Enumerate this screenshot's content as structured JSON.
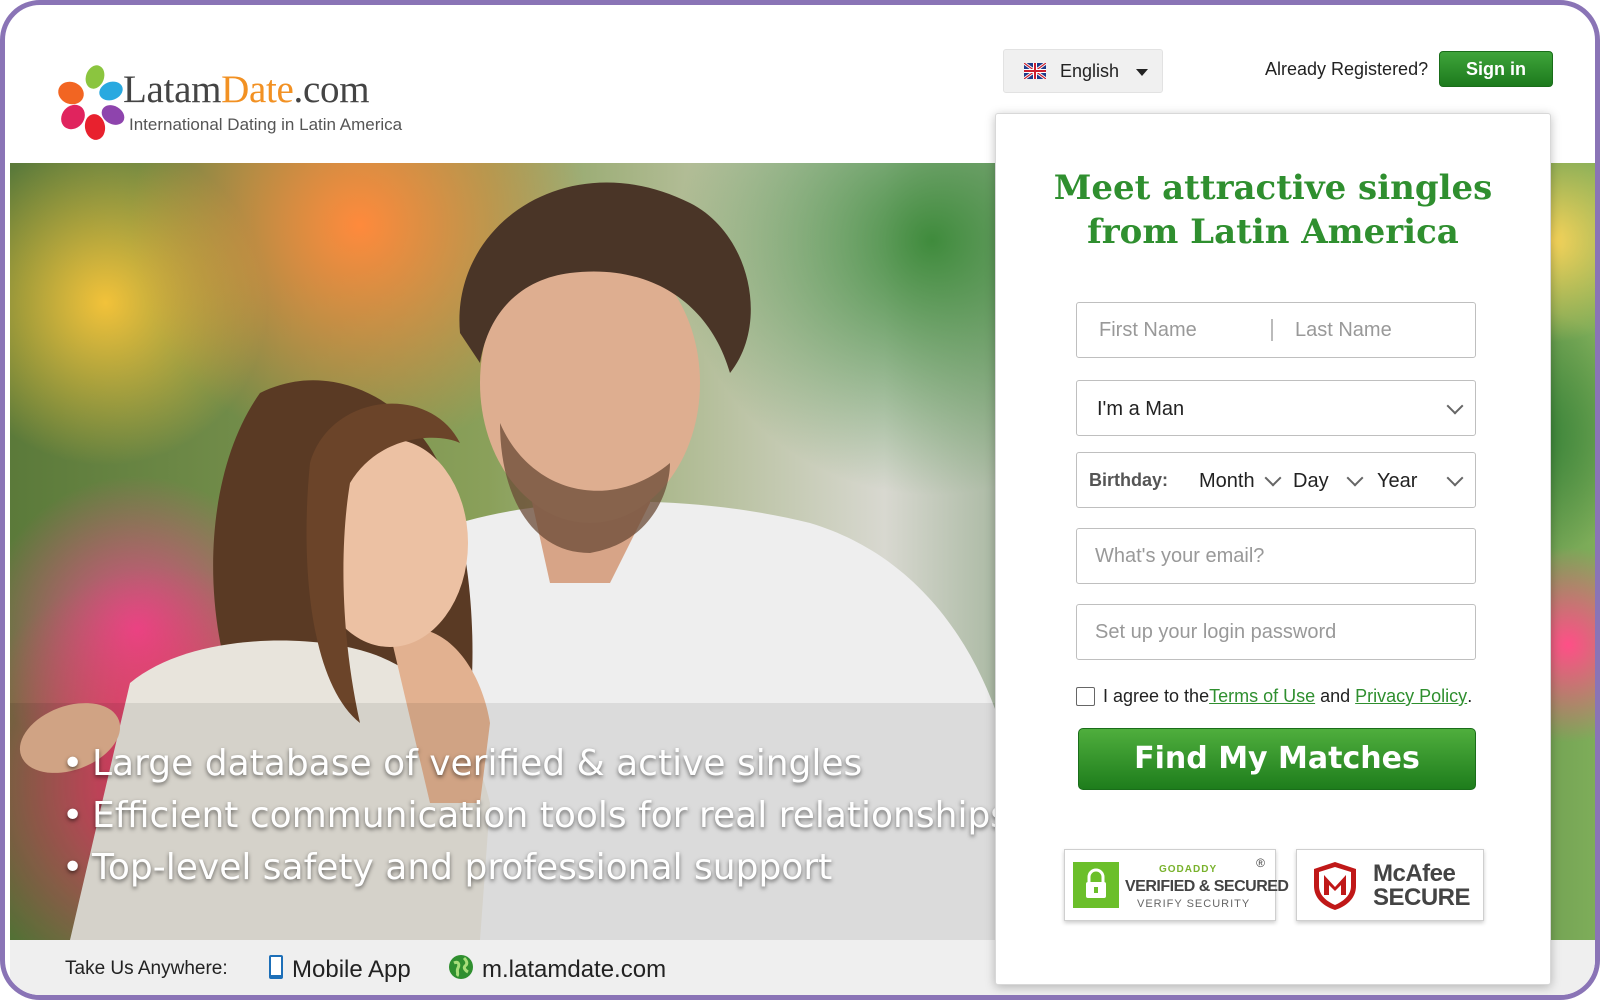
{
  "header": {
    "brand_name_part1": "Latam",
    "brand_name_part2": "Date",
    "brand_name_part3": ".com",
    "tagline": "International Dating in Latin America",
    "language_label": "English",
    "already_registered": "Already Registered?",
    "signin_label": "Sign in"
  },
  "hero": {
    "bullets": [
      "Large database of verified & active singles",
      "Efficient communication tools for real relationships",
      "Top-level safety and professional support"
    ]
  },
  "footer": {
    "take_us_anywhere": "Take Us Anywhere:",
    "mobile_app": "Mobile App",
    "mobile_site": "m.latamdate.com"
  },
  "form": {
    "title_line1": "Meet attractive singles",
    "title_line2": "from Latin America",
    "first_name_placeholder": "First Name",
    "last_name_placeholder": "Last Name",
    "gender_value": "I'm a Man",
    "birthday_label": "Birthday:",
    "month_label": "Month",
    "day_label": "Day",
    "year_label": "Year",
    "email_placeholder": "What's your email?",
    "password_placeholder": "Set up your login password",
    "agree_prefix": "I agree to the ",
    "terms_link": "Terms of Use",
    "agree_middle": " and ",
    "privacy_link": "Privacy Policy",
    "agree_suffix": ".",
    "submit_label": "Find My Matches"
  },
  "badges": {
    "godaddy_small": "GODADDY",
    "godaddy_main": "VERIFIED & SECURED",
    "godaddy_sub": "VERIFY SECURITY",
    "godaddy_reg": "®",
    "mcafee_line1": "McAfee",
    "mcafee_line2": "SECURE"
  },
  "colors": {
    "accent_green": "#2f8f2f",
    "brand_orange": "#f29123",
    "frame_purple": "#8a74b6"
  }
}
